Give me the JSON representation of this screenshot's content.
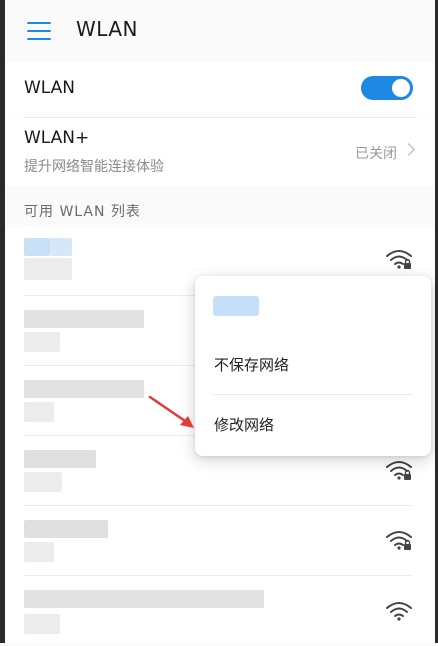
{
  "header": {
    "title": "WLAN",
    "menu_icon": "menu-icon"
  },
  "wlan_row": {
    "label": "WLAN",
    "enabled": true
  },
  "wlan_plus": {
    "label": "WLAN+",
    "subtitle": "提升网络智能连接体验",
    "status": "已关闭"
  },
  "available_list": {
    "header": "可用 WLAN 列表"
  },
  "context_menu": {
    "items": [
      "不保存网络",
      "修改网络"
    ]
  },
  "colors": {
    "accent": "#1e88e5",
    "background": "#fafafa"
  }
}
